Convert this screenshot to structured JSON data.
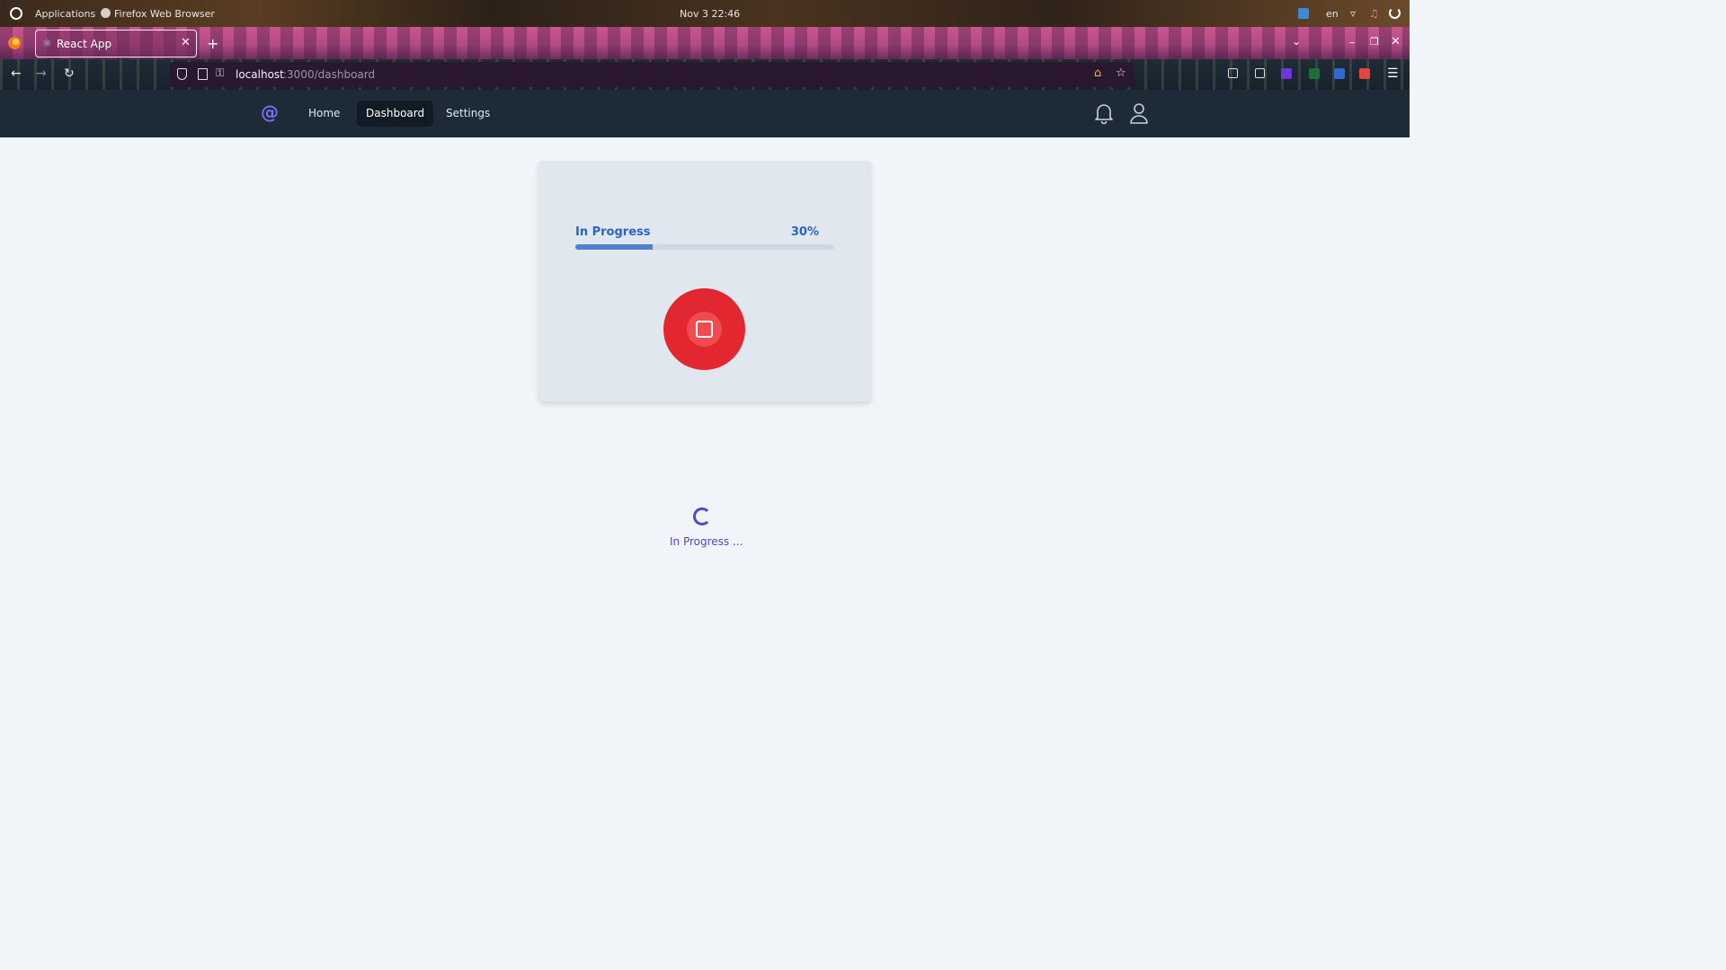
{
  "os": {
    "applications_label": "Applications",
    "app_label": "Firefox Web Browser",
    "clock": "Nov 3  22:46",
    "lang": "en"
  },
  "browser": {
    "tab_title": "React App",
    "url_host": "localhost",
    "url_path": ":3000/dashboard"
  },
  "app": {
    "brand": "@",
    "nav": [
      {
        "label": "Home",
        "active": false
      },
      {
        "label": "Dashboard",
        "active": true
      },
      {
        "label": "Settings",
        "active": false
      }
    ],
    "icons": [
      "bell-icon",
      "user-icon"
    ]
  },
  "card": {
    "status_label": "In Progress",
    "progress_text": "30%",
    "progress_value": 0.3,
    "stop_button_icon": "stop-icon"
  },
  "loading": {
    "text": "In Progress ..."
  },
  "colors": {
    "accent": "#2b63c4",
    "stop_button": "#e32731",
    "brand": "#7b6cf2",
    "spinner": "#5545c9"
  }
}
